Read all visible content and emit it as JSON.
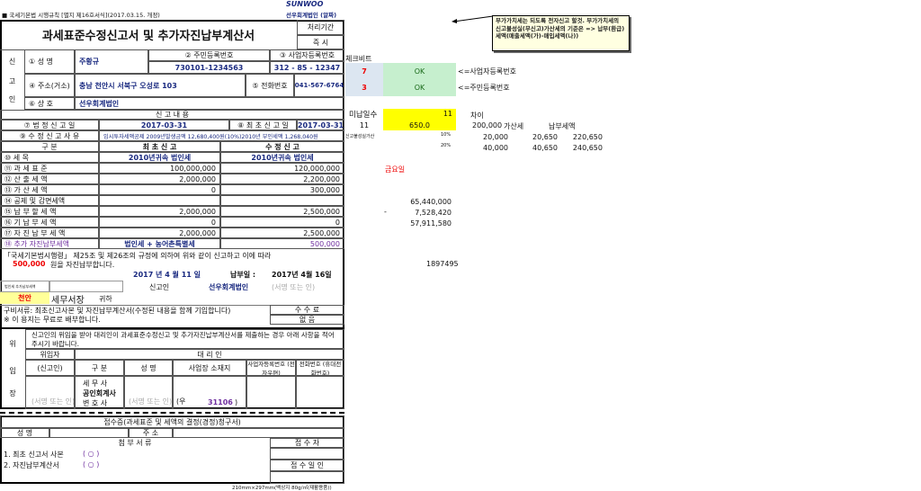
{
  "header": {
    "form_ref": "■ 국세기본법 시행규칙 [별지 제16호서식](2017.03.15. 개정)",
    "logo": "SUNWOO",
    "company_note": "선우회계법인 (알짜)"
  },
  "title": "과세표준수정신고서 및 추가자진납부계산서",
  "processing": {
    "label": "처리기간",
    "value": "즉 시"
  },
  "applicant": {
    "section_label": [
      "신",
      "고",
      "인"
    ],
    "name_label": "① 성 명",
    "name": "주황규",
    "rrn_label": "② 주민등록번호",
    "rrn": "730101-1234563",
    "brn_label": "③ 사업자등록번호",
    "brn": "312 - 85 - 12347",
    "address_label": "④ 주소(거소)",
    "address": "충남 천안시 서북구 오성로 103",
    "phone_label": "⑤ 전화번호",
    "phone": "041-567-6764",
    "trade_label": "⑥ 상 호",
    "trade": "선우회계법인"
  },
  "report": {
    "section_title": "신 고 내 용",
    "legal_date_label": "⑦ 법 정 신 고 일",
    "legal_date": "2017-03-31",
    "first_date_label": "⑧ 최 초 신 고 일",
    "first_date": "2017-03-31",
    "reason_label": "⑨ 수 정 신 고 사 유",
    "reason": "임시투자세액공제 2009년발생금액 12,680,400원(10%)2010년 부인세액 1,268,040원",
    "col_headers": [
      "구 분",
      "최 초 신 고",
      "수 정 신 고"
    ],
    "rows": [
      {
        "label": "⑩ 세 목",
        "first": "2010년귀속 법인세",
        "revised": "2010년귀속 법인세"
      },
      {
        "label": "⑪ 과 세 표 준",
        "first": "100,000,000",
        "revised": "120,000,000"
      },
      {
        "label": "⑫ 산 출 세 액",
        "first": "2,000,000",
        "revised": "2,200,000"
      },
      {
        "label": "⑬ 가 산 세 액",
        "first": "0",
        "revised": "300,000"
      },
      {
        "label": "⑭ 공제 및 감면세액",
        "first": "",
        "revised": ""
      },
      {
        "label": "⑮ 납 부 할 세 액",
        "first": "2,000,000",
        "revised": "2,500,000"
      },
      {
        "label": "⑯ 기 납 부 세 액",
        "first": "0",
        "revised": "0"
      },
      {
        "label": "⑰ 자 진 납 부 세 액",
        "first": "2,000,000",
        "revised": "2,500,000"
      },
      {
        "label": "⑱ 추가 자진납부세액",
        "first": "법인세 + 농어촌특별세",
        "revised": "500,000"
      }
    ]
  },
  "statement": {
    "line1": "「국세기본법시행령」 제25조 및 제26조의 규정에 의하여 위와 같이 신고하고 이에 따라",
    "amount": "500,000",
    "line2": "원을 자진납부합니다.",
    "date": "2017 년 4 월 11 일",
    "pay_date_label": "납부일 :",
    "pay_date": "2017년 4월 16일",
    "small_label": "법인세 추가납부세액",
    "reporter_label": "신고인",
    "reporter": "선우회계법인",
    "sign_hint": "(서명 또는 인)",
    "office": "천안",
    "office_suffix": "세무서장",
    "honorific": "귀하"
  },
  "docs": {
    "required": "구비서류: 최초신고사본 및 자진납부계산서(수정된 내용을 함께 기입합니다)",
    "free": "※ 이 용지는 무료로 배부합니다.",
    "fee_label": "수 수 료",
    "fee": "없 음"
  },
  "proxy": {
    "side": [
      "위",
      "임",
      "장"
    ],
    "intro": "신고인의 위임을 받아 대리인이 과세표준수정신고 및 추가자진납부계산서를 제출하는 경우 아래 사항을 적어 주시기 바랍니다.",
    "delegator": "위임자",
    "delegator_sub": "(신고인)",
    "agent": "대 리 인",
    "cols": [
      "구 분",
      "성 명",
      "사업장 소재지",
      "사업자등록번호 (전자우편)",
      "전화번호 (휴대전화번호)"
    ],
    "types": [
      "세 무 사",
      "공인회계사",
      "변 호 사"
    ],
    "sign_hint": "(서명 또는 인)",
    "postal_prefix": "(우",
    "postal": "31106",
    "postal_suffix": ")"
  },
  "receipt": {
    "title": "접수증(과세표준 및 세액의 결정(경정)청구서)",
    "name_label": "성 명",
    "address_label": "주 소",
    "attach_label": "첨 부 서 류",
    "items": [
      "1. 최초 신고서 사본",
      "2. 자진납부계산서"
    ],
    "mark": "( ○ )",
    "receiver": "접 수 자",
    "receive_date": "접 수 일 인"
  },
  "footer": "210mm×297mm(백상지 80g/㎡(재활용품))",
  "side": {
    "check_label": "체크비트",
    "checks": [
      {
        "digit": "7",
        "status": "OK",
        "note": "<=사업자등록번호"
      },
      {
        "digit": "3",
        "status": "OK",
        "note": "<=주민등록번호"
      }
    ],
    "unpaid_label": "미납일수",
    "unpaid_days": "11",
    "days": "11",
    "rate_value": "650.0",
    "diff_label": "차이",
    "diff": "200,000",
    "penalty_label": "가산세",
    "pay_label": "납부세액",
    "faith_label": "신고불성실가산",
    "rows": [
      {
        "pct": "10%",
        "a": "20,000",
        "b": "20,650",
        "c": "220,650"
      },
      {
        "pct": "20%",
        "a": "40,000",
        "b": "40,650",
        "c": "240,650"
      }
    ],
    "weekday": "금요일",
    "calc": [
      "65,440,000",
      "7,528,420",
      "57,911,580"
    ],
    "minus": "-",
    "code": "1897495",
    "comment": "부가가치세는 되도록 전자신고 할것. 부가가치세의 신고불성실(무신고)가산세의 기준은 => 납부(환급)세액(매출세액(가)-매입세액(나))"
  },
  "colors": {
    "navy": "#1a2a80",
    "purple": "#7030a0",
    "yellow": "#ffff00",
    "green": "#c6efce",
    "blue": "#dce6f1",
    "red": "#e00000"
  }
}
